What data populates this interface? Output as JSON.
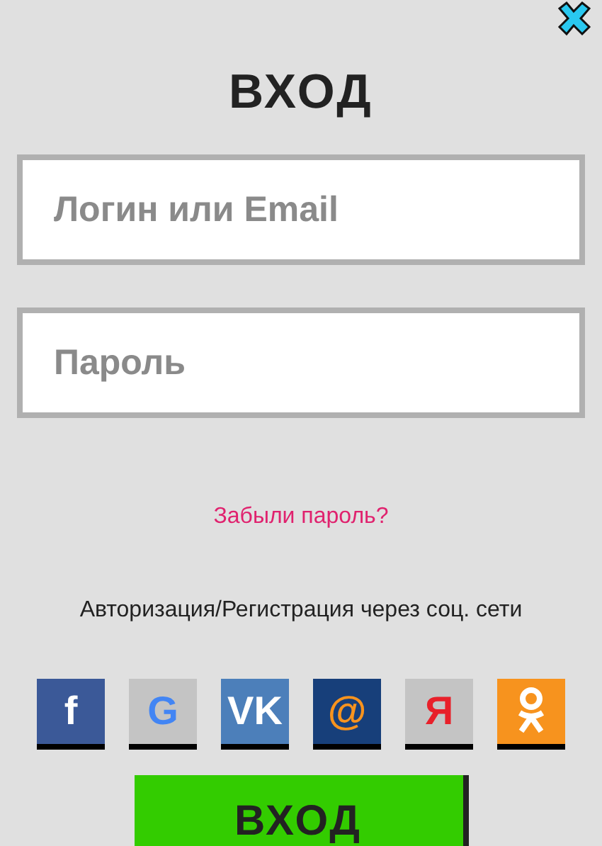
{
  "title": "ВХОД",
  "fields": [
    {
      "placeholder": "Логин или Email"
    },
    {
      "placeholder": "Пароль"
    }
  ],
  "forgot_link": "Забыли пароль?",
  "social_caption": "Авторизация/Регистрация через соц. сети",
  "social": [
    {
      "kind": "letter",
      "glyph": "f",
      "color": "#3b5998"
    },
    {
      "kind": "letter",
      "glyph": "G",
      "color": "#c4c4c4"
    },
    {
      "kind": "letter",
      "glyph": "VK",
      "color": "#4c7fba"
    },
    {
      "kind": "letter",
      "glyph": "@",
      "color": "#173f7a"
    },
    {
      "kind": "letter",
      "glyph": "Я",
      "color": "#c4c4c4"
    },
    {
      "kind": "figure",
      "color": "#f7931e"
    }
  ],
  "submit": "ВХОД"
}
